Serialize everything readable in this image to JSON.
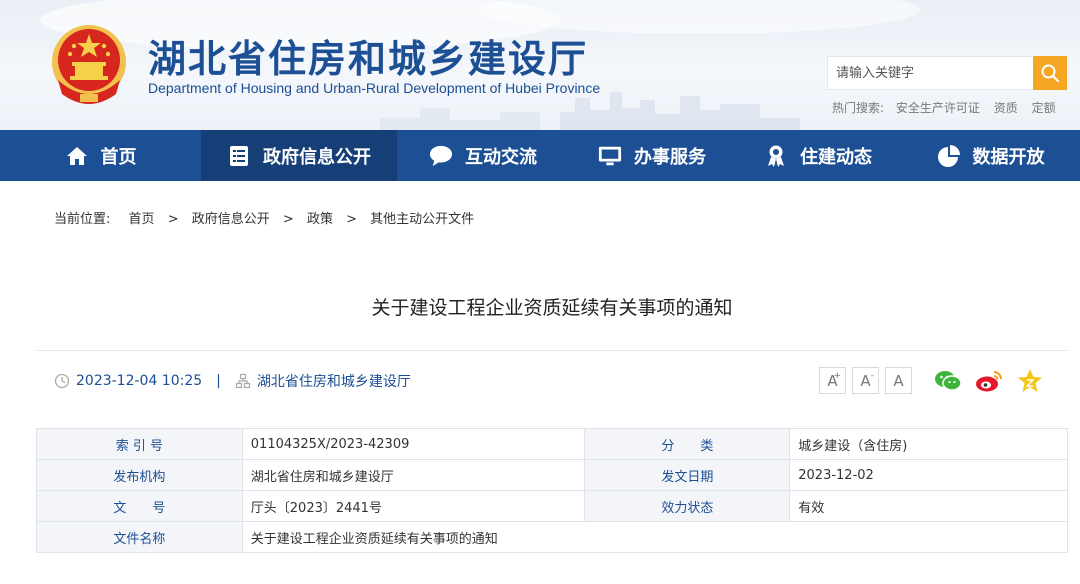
{
  "header": {
    "title": "湖北省住房和城乡建设厅",
    "subtitle": "Department of Housing and Urban-Rural Development of Hubei Province",
    "emblem_icon": "national-emblem-icon"
  },
  "search": {
    "placeholder": "请输入关键字",
    "hot_label": "热门搜索:",
    "hot_terms": [
      "安全生产许可证",
      "资质",
      "定额"
    ],
    "accent": "#f5a623"
  },
  "nav": {
    "items": [
      {
        "label": "首页",
        "icon": "home-icon"
      },
      {
        "label": "政府信息公开",
        "icon": "document-list-icon",
        "active": true
      },
      {
        "label": "互动交流",
        "icon": "chat-bubble-icon"
      },
      {
        "label": "办事服务",
        "icon": "monitor-icon"
      },
      {
        "label": "住建动态",
        "icon": "award-ribbon-icon"
      },
      {
        "label": "数据开放",
        "icon": "pie-chart-icon"
      }
    ],
    "background": "#1c4f94",
    "active_background": "#163f78"
  },
  "breadcrumb": {
    "label": "当前位置:",
    "items": [
      "首页",
      "政府信息公开",
      "政策",
      "其他主动公开文件"
    ],
    "separator": ">"
  },
  "article": {
    "title": "关于建设工程企业资质延续有关事项的通知",
    "datetime": "2023-12-04 10:25",
    "divider": "|",
    "source": "湖北省住房和城乡建设厅"
  },
  "font_tools": [
    "A",
    "A",
    "A"
  ],
  "share": [
    "wechat-icon",
    "weibo-icon",
    "favorite-star-icon"
  ],
  "info": {
    "rows": [
      {
        "k1": "索 引 号",
        "v1": "01104325X/2023-42309",
        "k2": "分　　类",
        "v2": "城乡建设（含住房)"
      },
      {
        "k1": "发布机构",
        "v1": "湖北省住房和城乡建设厅",
        "k2": "发文日期",
        "v2": "2023-12-02"
      },
      {
        "k1": "文　　号",
        "v1": "厅头〔2023〕2441号",
        "k2": "效力状态",
        "v2": "有效"
      }
    ],
    "name_label": "文件名称",
    "name_value": "关于建设工程企业资质延续有关事项的通知"
  }
}
